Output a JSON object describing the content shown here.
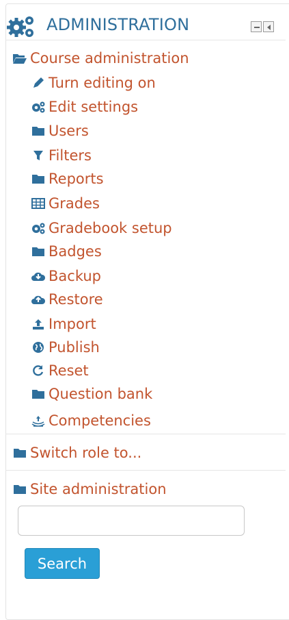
{
  "colors": {
    "link": "#c2542e",
    "header": "#2f6f9c",
    "icon": "#2f6f9c",
    "button": "#2a9fd6"
  },
  "block": {
    "title": "ADMINISTRATION",
    "title_icon": "gears-icon",
    "controls": [
      "minimize-icon",
      "dock-icon"
    ]
  },
  "course_admin": {
    "label": "Course administration",
    "icon": "folder-open-icon",
    "items": [
      {
        "label": "Turn editing on",
        "icon": "pencil-icon"
      },
      {
        "label": "Edit settings",
        "icon": "gears-icon"
      },
      {
        "label": "Users",
        "icon": "folder-icon"
      },
      {
        "label": "Filters",
        "icon": "filter-icon"
      },
      {
        "label": "Reports",
        "icon": "folder-icon"
      },
      {
        "label": "Grades",
        "icon": "table-icon"
      },
      {
        "label": "Gradebook setup",
        "icon": "gears-icon"
      },
      {
        "label": "Badges",
        "icon": "folder-icon"
      },
      {
        "label": "Backup",
        "icon": "cloud-download-icon"
      },
      {
        "label": "Restore",
        "icon": "cloud-upload-icon"
      },
      {
        "label": "Import",
        "icon": "upload-icon"
      },
      {
        "label": "Publish",
        "icon": "globe-icon"
      },
      {
        "label": "Reset",
        "icon": "reset-icon"
      },
      {
        "label": "Question bank",
        "icon": "folder-icon"
      },
      {
        "label": "Competencies",
        "icon": "competencies-icon"
      }
    ]
  },
  "switch_role": {
    "label": "Switch role to...",
    "icon": "folder-icon"
  },
  "site_admin": {
    "label": "Site administration",
    "icon": "folder-icon"
  },
  "search": {
    "value": "",
    "button_label": "Search"
  }
}
